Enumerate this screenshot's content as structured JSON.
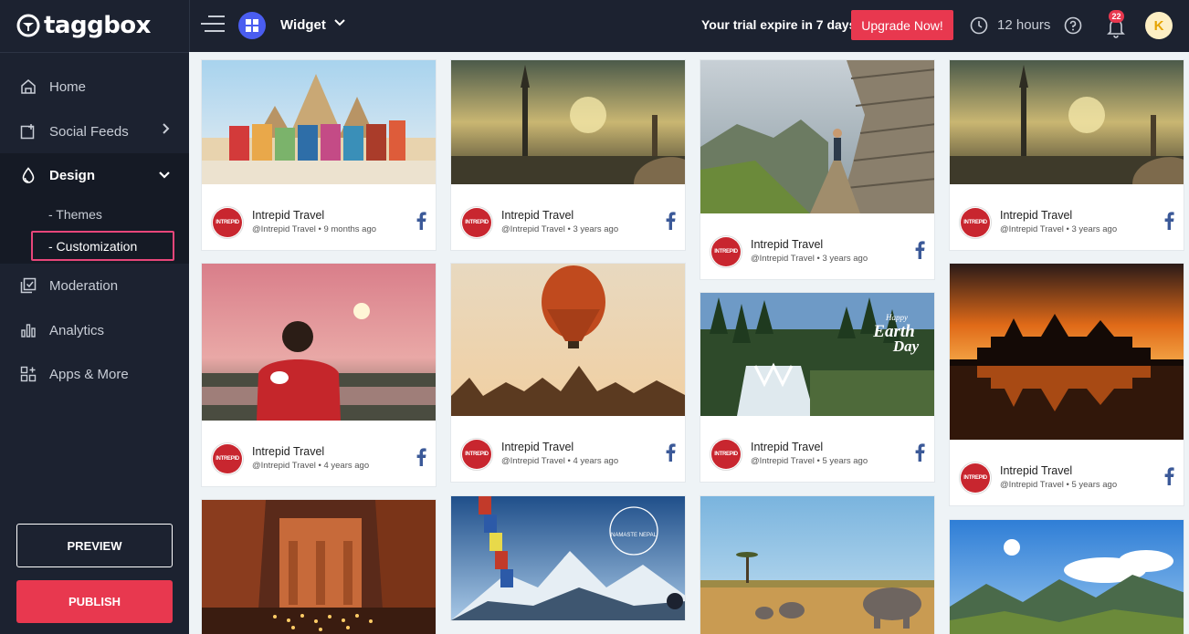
{
  "sidebar": {
    "logo": "taggbox",
    "nav": [
      {
        "label": "Home",
        "icon": "home-icon"
      },
      {
        "label": "Social Feeds",
        "icon": "add-feed-icon"
      },
      {
        "label": "Design",
        "icon": "droplet-icon"
      },
      {
        "label": "Moderation",
        "icon": "moderation-icon"
      },
      {
        "label": "Analytics",
        "icon": "analytics-icon"
      },
      {
        "label": "Apps & More",
        "icon": "apps-icon"
      }
    ],
    "design_sub": [
      "- Themes",
      "- Customization"
    ],
    "preview_label": "PREVIEW",
    "publish_label": "PUBLISH"
  },
  "topbar": {
    "widget_label": "Widget",
    "trial_text": "Your trial expire in 7 days.",
    "upgrade_label": "Upgrade Now!",
    "hours_text": "12 hours",
    "notification_count": "22",
    "avatar_letter": "K"
  },
  "posts": [
    {
      "author": "Intrepid Travel",
      "handle": "@Intrepid Travel",
      "time": "9 months ago",
      "network": "facebook"
    },
    {
      "author": "Intrepid Travel",
      "handle": "@Intrepid Travel",
      "time": "3 years ago",
      "network": "facebook"
    },
    {
      "author": "Intrepid Travel",
      "handle": "@Intrepid Travel",
      "time": "3 years ago",
      "network": "facebook"
    },
    {
      "author": "Intrepid Travel",
      "handle": "@Intrepid Travel",
      "time": "3 years ago",
      "network": "facebook"
    },
    {
      "author": "Intrepid Travel",
      "handle": "@Intrepid Travel",
      "time": "4 years ago",
      "network": "facebook"
    },
    {
      "author": "Intrepid Travel",
      "handle": "@Intrepid Travel",
      "time": "4 years ago",
      "network": "facebook"
    },
    {
      "author": "Intrepid Travel",
      "handle": "@Intrepid Travel",
      "time": "5 years ago",
      "network": "facebook"
    },
    {
      "author": "Intrepid Travel",
      "handle": "@Intrepid Travel",
      "time": "5 years ago",
      "network": "facebook"
    }
  ],
  "overlays": {
    "earth_day_1": "Happy",
    "earth_day_2": "Earth",
    "earth_day_3": "Day",
    "namaste": "NAMASTE NEPAL"
  },
  "colors": {
    "sidebar_bg": "#1c2230",
    "accent_red": "#e8384f",
    "highlight_pink": "#e8467a",
    "facebook_blue": "#3b5998"
  }
}
